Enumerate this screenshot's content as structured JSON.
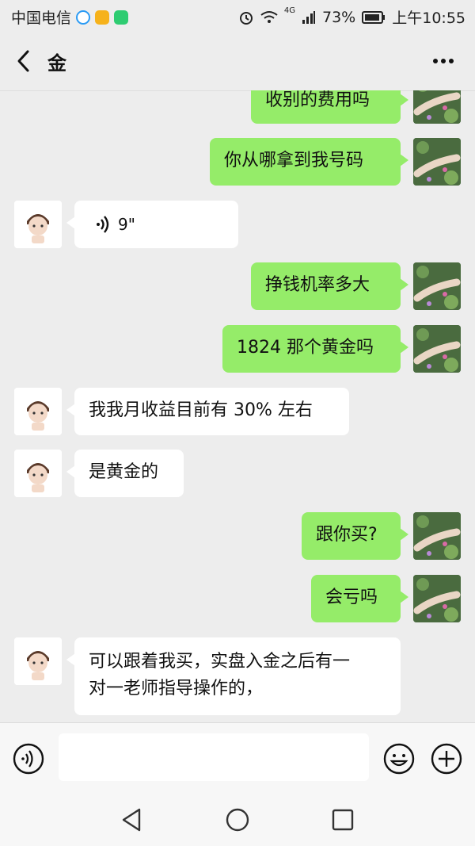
{
  "status_bar": {
    "carrier": "中国电信",
    "network": "4G",
    "battery": "73%",
    "time": "上午10:55"
  },
  "header": {
    "title": "金"
  },
  "messages": [
    {
      "side": "right",
      "text": "收别的费用吗"
    },
    {
      "side": "right",
      "text": "你从哪拿到我号码"
    },
    {
      "side": "left",
      "type": "voice",
      "text": "9\""
    },
    {
      "side": "right",
      "text": "挣钱机率多大"
    },
    {
      "side": "right",
      "text": "1824 那个黄金吗"
    },
    {
      "side": "left",
      "text": "我我月收益目前有 30% 左右"
    },
    {
      "side": "left",
      "text": "是黄金的"
    },
    {
      "side": "right",
      "text": "跟你买?"
    },
    {
      "side": "right",
      "text": "会亏吗"
    },
    {
      "side": "left",
      "text_line1": "可以跟着我买，实盘入金之后有一",
      "text_line2": "对一老师指导操作的，"
    }
  ],
  "input": {
    "value": "",
    "placeholder": ""
  },
  "colors": {
    "background": "#ededed",
    "sent_bubble": "#95ec69",
    "received_bubble": "#ffffff"
  },
  "icons": [
    "back-arrow-icon",
    "more-icon",
    "voice-icon",
    "emoji-icon",
    "plus-icon",
    "nav-back-icon",
    "nav-home-icon",
    "nav-recent-icon"
  ]
}
